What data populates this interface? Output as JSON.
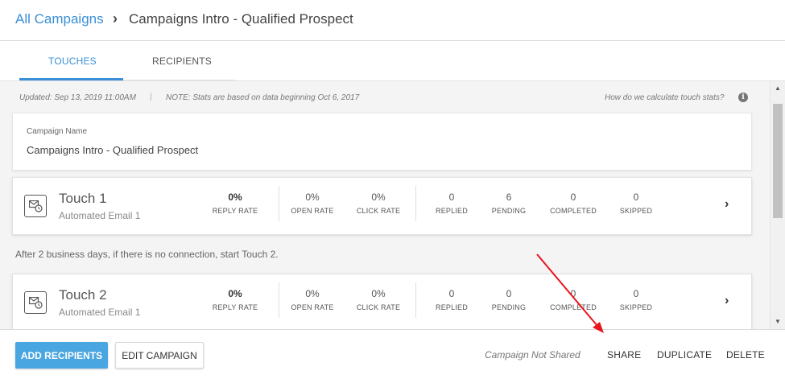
{
  "breadcrumb": {
    "parent": "All Campaigns",
    "separator": "›",
    "current": "Campaigns Intro - Qualified Prospect"
  },
  "tabs": [
    {
      "label": "TOUCHES",
      "active": true
    },
    {
      "label": "RECIPIENTS",
      "active": false
    }
  ],
  "stats_bar": {
    "updated": "Updated: Sep 13, 2019 11:00AM",
    "separator": "|",
    "note": "NOTE: Stats are based on data beginning Oct 6, 2017",
    "help_link": "How do we calculate touch stats?",
    "info_icon": "info-icon"
  },
  "campaign": {
    "name_label": "Campaign Name",
    "name_value": "Campaigns Intro - Qualified Prospect"
  },
  "touches": [
    {
      "title": "Touch 1",
      "subtitle": "Automated Email 1",
      "icon": "email-clock-icon",
      "stats": [
        {
          "value": "0%",
          "label": "REPLY RATE"
        },
        {
          "value": "0%",
          "label": "OPEN RATE"
        },
        {
          "value": "0%",
          "label": "CLICK RATE"
        },
        {
          "value": "0",
          "label": "REPLIED"
        },
        {
          "value": "6",
          "label": "PENDING"
        },
        {
          "value": "0",
          "label": "COMPLETED"
        },
        {
          "value": "0",
          "label": "SKIPPED"
        }
      ]
    },
    {
      "title": "Touch 2",
      "subtitle": "Automated Email 1",
      "icon": "email-clock-icon",
      "stats": [
        {
          "value": "0%",
          "label": "REPLY RATE"
        },
        {
          "value": "0%",
          "label": "OPEN RATE"
        },
        {
          "value": "0%",
          "label": "CLICK RATE"
        },
        {
          "value": "0",
          "label": "REPLIED"
        },
        {
          "value": "0",
          "label": "PENDING"
        },
        {
          "value": "0",
          "label": "COMPLETED"
        },
        {
          "value": "0",
          "label": "SKIPPED"
        }
      ]
    }
  ],
  "delay_text": "After 2 business days, if there is no connection, start Touch 2.",
  "footer": {
    "add_recipients": "ADD RECIPIENTS",
    "edit_campaign": "EDIT CAMPAIGN",
    "share_status": "Campaign Not Shared",
    "share": "SHARE",
    "duplicate": "DUPLICATE",
    "delete": "DELETE"
  },
  "colors": {
    "accent": "#3a8fd6",
    "primary_button": "#4aa6e0",
    "annotation_arrow": "#e8141c"
  }
}
